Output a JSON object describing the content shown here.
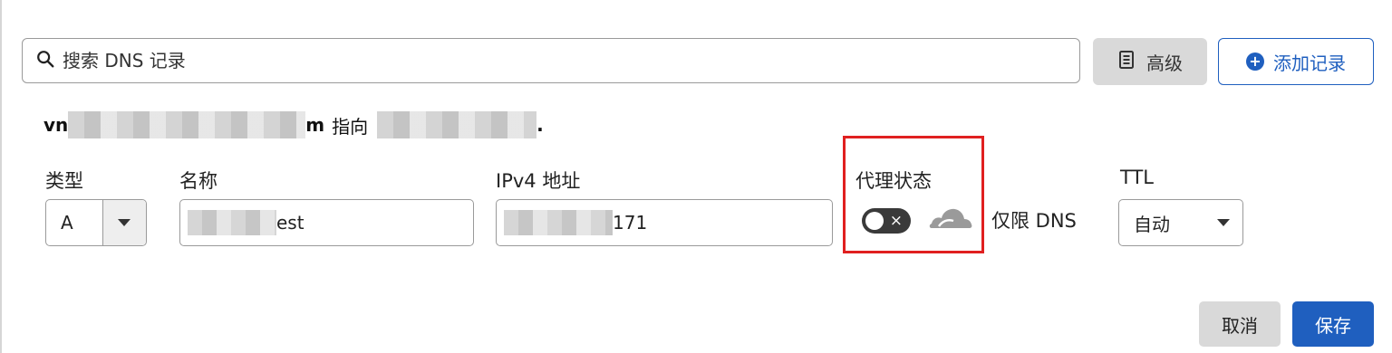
{
  "search": {
    "placeholder": "搜索 DNS 记录"
  },
  "toolbar": {
    "advanced_label": "高级",
    "add_record_label": "添加记录"
  },
  "summary": {
    "prefix": "vn",
    "suffix": "m",
    "points_to": "指向",
    "tail": "."
  },
  "form": {
    "type_label": "类型",
    "type_value": "A",
    "name_label": "名称",
    "name_value_visible": "est",
    "ipv4_label": "IPv4 地址",
    "ipv4_value_visible": "171",
    "proxy_label": "代理状态",
    "proxy_toggle_symbol": "×",
    "proxy_mode_text": "仅限 DNS",
    "ttl_label": "TTL",
    "ttl_value": "自动"
  },
  "actions": {
    "cancel_label": "取消",
    "save_label": "保存"
  },
  "colors": {
    "accent": "#1f5fbf",
    "highlight_border": "#e02020",
    "toggle_off": "#3a3a3a",
    "cloud_gray": "#9a9a9a"
  },
  "icons": [
    "search-icon",
    "document-icon",
    "plus-circle-icon",
    "cloud-icon",
    "chevron-down-icon"
  ]
}
